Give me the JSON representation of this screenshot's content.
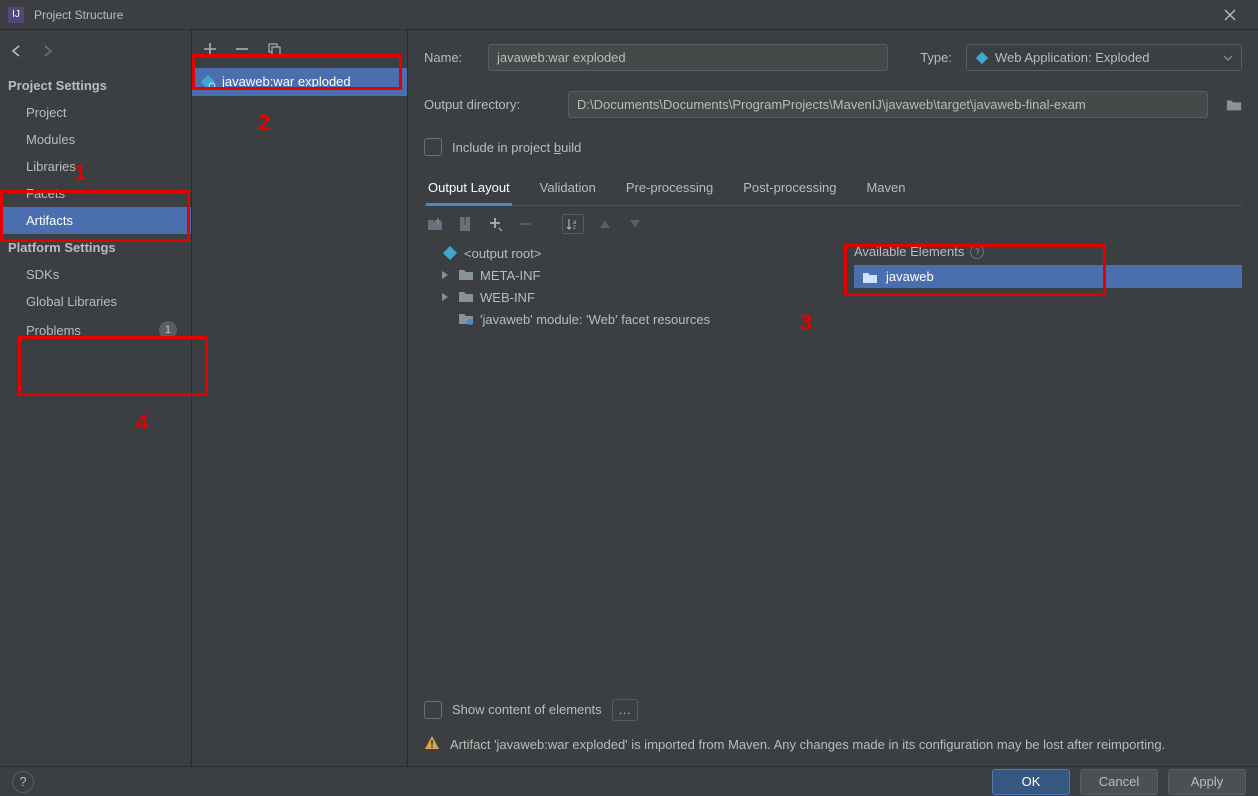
{
  "window": {
    "title": "Project Structure"
  },
  "leftnav": {
    "section_project_settings": "Project Settings",
    "items1": [
      "Project",
      "Modules",
      "Libraries",
      "Facets",
      "Artifacts"
    ],
    "selected1_index": 4,
    "section_platform_settings": "Platform Settings",
    "items2": [
      "SDKs",
      "Global Libraries"
    ],
    "problems_label": "Problems",
    "problems_count": "1"
  },
  "artifacts": {
    "item_label": "javaweb:war exploded"
  },
  "detail": {
    "name_label": "Name:",
    "name_value": "javaweb:war exploded",
    "type_label": "Type:",
    "type_value": "Web Application: Exploded",
    "outputdir_label": "Output directory:",
    "outputdir_value": "D:\\Documents\\Documents\\ProgramProjects\\MavenIJ\\javaweb\\target\\javaweb-final-exam",
    "include_build_prefix": "Include in project ",
    "include_build_uchar": "b",
    "include_build_suffix": "uild",
    "tabs": [
      "Output Layout",
      "Validation",
      "Pre-processing",
      "Post-processing",
      "Maven"
    ],
    "active_tab_index": 0,
    "tree": {
      "root": "<output root>",
      "children": [
        "META-INF",
        "WEB-INF"
      ],
      "facet_line": "'javaweb' module: 'Web' facet resources"
    },
    "available_header": "Available Elements",
    "available_item": "javaweb",
    "show_content_label": "Show content of elements",
    "warning_text": "Artifact 'javaweb:war exploded' is imported from Maven. Any changes made in its configuration may be lost after reimporting."
  },
  "footer": {
    "ok": "OK",
    "cancel": "Cancel",
    "apply": "Apply"
  },
  "annotations": {
    "n1": "1",
    "n2": "2",
    "n3": "3",
    "n4": "4"
  }
}
